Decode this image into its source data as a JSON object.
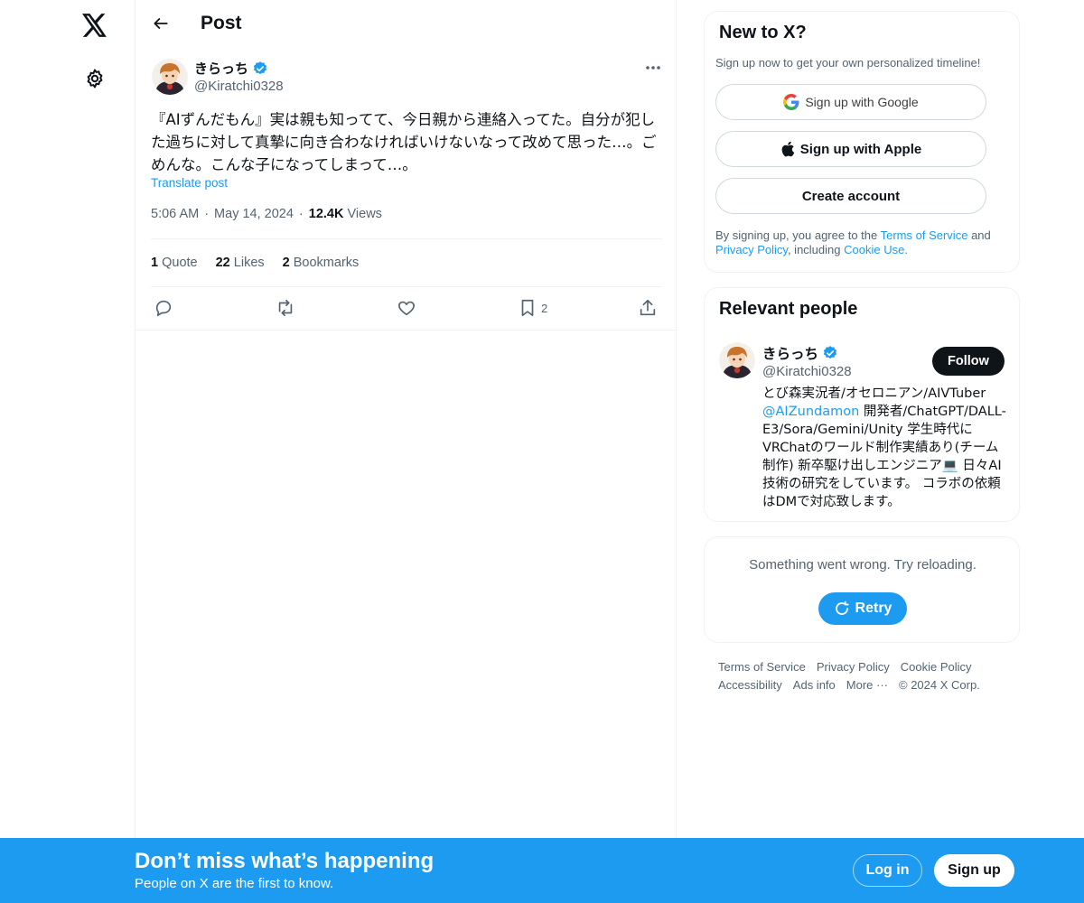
{
  "nav": {
    "logo_icon": "x-logo-icon",
    "settings_icon": "gear-icon"
  },
  "header": {
    "title": "Post",
    "back_icon": "arrow-left-icon"
  },
  "post": {
    "author_name": "きらっち",
    "author_handle": "@Kiratchi0328",
    "verified": true,
    "text": "『AIずんだもん』実は親も知ってて、今日親から連絡入ってた。自分が犯した過ちに対して真摯に向き合わなければいけないなって改めて思った…。ごめんな。こんな子になってしまって…。",
    "translate_label": "Translate post",
    "time": "5:06 AM",
    "date": "May 14, 2024",
    "views_count": "12.4K",
    "views_label": "Views",
    "quotes_count": "1",
    "quotes_label": "Quote",
    "likes_count": "22",
    "likes_label": "Likes",
    "bookmarks_count": "2",
    "bookmarks_label": "Bookmarks",
    "bookmark_action_count": "2"
  },
  "signup_card": {
    "title": "New to X?",
    "subtitle": "Sign up now to get your own personalized timeline!",
    "google_label": "Sign up with Google",
    "apple_label": "Sign up with Apple",
    "create_label": "Create account",
    "legal_prefix": "By signing up, you agree to the",
    "terms_link": "Terms of Service",
    "and_text": "and",
    "privacy_link": "Privacy Policy",
    "including_text": ", including",
    "cookie_link": "Cookie Use."
  },
  "relevant_people": {
    "title": "Relevant people",
    "name": "きらっち",
    "handle": "@Kiratchi0328",
    "follow_label": "Follow",
    "bio_before": "とび森実況者/オセロニアン/AIVTuber",
    "bio_link": "@AIZundamon",
    "bio_after": "開発者/ChatGPT/DALL-E3/Sora/Gemini/Unity 学生時代にVRChatのワールド制作実績あり(チーム制作) 新卒駆け出しエンジニア💻 日々AI技術の研究をしています。 コラボの依頼はDMで対応致します。"
  },
  "error_card": {
    "message": "Something went wrong. Try reloading.",
    "retry_label": "Retry"
  },
  "footer": {
    "row1": [
      "Terms of Service",
      "Privacy Policy",
      "Cookie Policy"
    ],
    "row2": [
      "Accessibility",
      "Ads info",
      "More ···",
      "© 2024 X Corp."
    ]
  },
  "banner": {
    "title": "Don’t miss what’s happening",
    "subtitle": "People on X are the first to know.",
    "login_label": "Log in",
    "signup_label": "Sign up"
  },
  "colors": {
    "accent": "#1d9bf0",
    "text": "#0f1419",
    "muted": "#536471",
    "border": "#eff3f4"
  }
}
